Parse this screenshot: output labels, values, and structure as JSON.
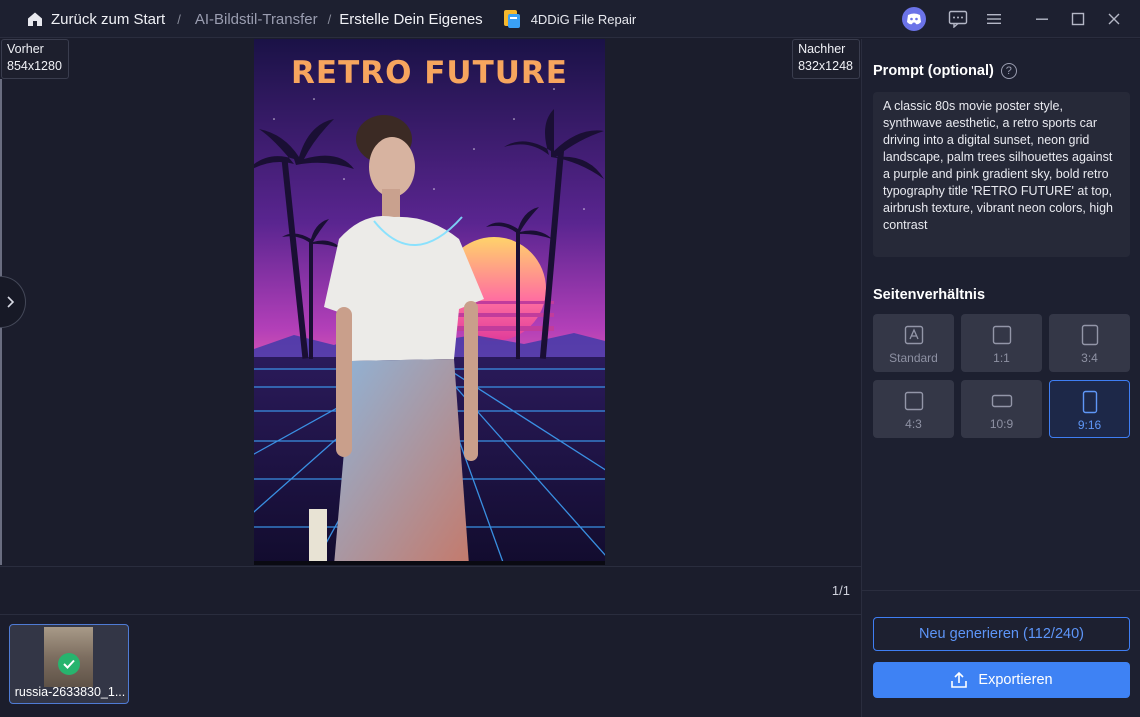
{
  "titlebar": {
    "breadcrumb_home": "Zurück zum Start",
    "breadcrumb_sep": "/",
    "breadcrumb_mid": "AI-Bildstil-Transfer",
    "breadcrumb_sep2": "/",
    "breadcrumb_current": "Erstelle Dein Eigenes",
    "app_name": "4DDiG File Repair",
    "icons": [
      "home-icon",
      "app-logo-icon",
      "discord-icon",
      "feedback-icon",
      "menu-icon",
      "minimize-icon",
      "maximize-icon",
      "close-icon"
    ]
  },
  "canvas": {
    "before_label": "Vorher",
    "before_size": "854x1280",
    "after_label": "Nachher",
    "after_size": "832x1248",
    "poster_title": "RETRO FUTURE",
    "pager": "1/1"
  },
  "thumbnails": [
    {
      "name": "russia-2633830_1...",
      "status": "done"
    }
  ],
  "panel": {
    "prompt_title": "Prompt (optional)",
    "prompt_text": "A classic 80s movie poster style, synthwave aesthetic, a retro sports car driving into a digital sunset, neon grid landscape, palm trees silhouettes against a purple and pink gradient sky, bold retro typography title 'RETRO FUTURE' at top, airbrush texture, vibrant neon colors, high contrast",
    "ratio_title": "Seitenverhältnis",
    "ratios": [
      {
        "label": "Standard",
        "icon": "standard-icon",
        "active": false
      },
      {
        "label": "1:1",
        "icon": "square-icon",
        "active": false
      },
      {
        "label": "3:4",
        "icon": "portrait-icon",
        "active": false
      },
      {
        "label": "4:3",
        "icon": "landscape-icon",
        "active": false
      },
      {
        "label": "10:9",
        "icon": "wide-icon",
        "active": false
      },
      {
        "label": "9:16",
        "icon": "tall-icon",
        "active": true
      }
    ],
    "regenerate_label": "Neu generieren (112/240)",
    "export_label": "Exportieren"
  },
  "colors": {
    "accent": "#3e82f4",
    "background": "#1b1d2c",
    "panel": "#1d2030",
    "success": "#27b46e"
  }
}
